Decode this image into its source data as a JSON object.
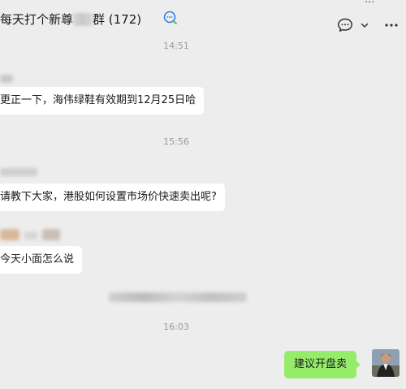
{
  "window": {
    "title": "每天打个新尊贵群 (172)",
    "title_prefix": "每天打个新尊",
    "title_suffix": "群 (172)",
    "top_dots": "···"
  },
  "messages": [
    {
      "type": "timestamp",
      "text": "14:51"
    },
    {
      "type": "incoming",
      "text": "更正一下，海伟绿鞋有效期到12月25日哈"
    },
    {
      "type": "timestamp",
      "text": "15:56"
    },
    {
      "type": "incoming",
      "text": "请教下大家，港股如何设置市场价快速卖出呢?"
    },
    {
      "type": "incoming",
      "text": "今天小面怎么说"
    },
    {
      "type": "timestamp",
      "text": "16:03"
    },
    {
      "type": "outgoing",
      "text": "建议开盘卖"
    }
  ],
  "icons": {
    "group_badge": "chat-bubble-ring-icon",
    "chat_menu": "chat-bubble-icon",
    "dropdown": "chevron-down-icon",
    "more": "more-dots-icon"
  },
  "colors": {
    "background": "#ededed",
    "incoming_bubble": "#ffffff",
    "outgoing_bubble": "#95ec69",
    "accent": "#2f80ed"
  }
}
